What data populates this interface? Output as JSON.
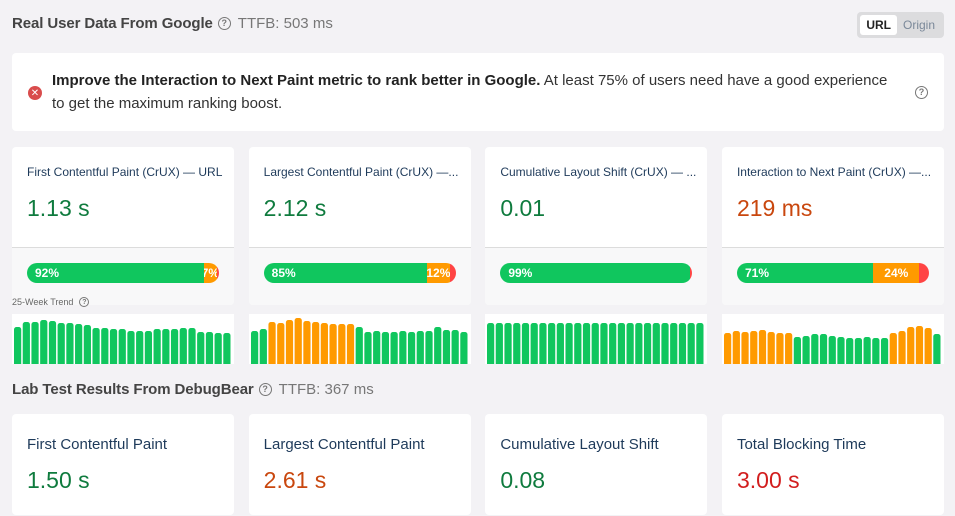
{
  "real_user": {
    "title": "Real User Data From Google",
    "ttfb": "TTFB: 503 ms",
    "help": "?",
    "toggle": {
      "options": [
        "URL",
        "Origin"
      ],
      "selected": "URL"
    }
  },
  "alert": {
    "icon": "error-icon",
    "bold_text": "Improve the Interaction to Next Paint metric to rank better in Google.",
    "text": " At least 75% of users need have a good experience to get the maximum ranking boost.",
    "help": "?"
  },
  "crux_cards": [
    {
      "title": "First Contentful Paint (CrUX) — URL",
      "value": "1.13 s",
      "rating": "good",
      "distribution": {
        "good": 92,
        "needs_improvement": 7,
        "poor": 1
      },
      "labels": {
        "good": "92%",
        "needs_improvement": "7%",
        "poor": ""
      }
    },
    {
      "title": "Largest Contentful Paint (CrUX) —...",
      "value": "2.12 s",
      "rating": "good",
      "distribution": {
        "good": 85,
        "needs_improvement": 12,
        "poor": 3
      },
      "labels": {
        "good": "85%",
        "needs_improvement": "12%",
        "poor": ""
      }
    },
    {
      "title": "Cumulative Layout Shift (CrUX) — ...",
      "value": "0.01",
      "rating": "good",
      "distribution": {
        "good": 99,
        "needs_improvement": 0,
        "poor": 1
      },
      "labels": {
        "good": "99%",
        "needs_improvement": "",
        "poor": ""
      }
    },
    {
      "title": "Interaction to Next Paint (CrUX) —...",
      "value": "219 ms",
      "rating": "ni",
      "distribution": {
        "good": 71,
        "needs_improvement": 24,
        "poor": 5
      },
      "labels": {
        "good": "71%",
        "needs_improvement": "24%",
        "poor": ""
      }
    }
  ],
  "trend": {
    "label": "25-Week Trend",
    "help": "?",
    "colors": {
      "good": "#10c65e",
      "ni": "#ff9a00"
    },
    "series": [
      {
        "metric": "fcp",
        "values": [
          0.74,
          0.84,
          0.84,
          0.88,
          0.86,
          0.82,
          0.82,
          0.8,
          0.78,
          0.72,
          0.72,
          0.7,
          0.7,
          0.66,
          0.66,
          0.66,
          0.7,
          0.7,
          0.7,
          0.72,
          0.72,
          0.64,
          0.64,
          0.62,
          0.62
        ],
        "ratings": [
          "good",
          "good",
          "good",
          "good",
          "good",
          "good",
          "good",
          "good",
          "good",
          "good",
          "good",
          "good",
          "good",
          "good",
          "good",
          "good",
          "good",
          "good",
          "good",
          "good",
          "good",
          "good",
          "good",
          "good",
          "good"
        ]
      },
      {
        "metric": "lcp",
        "values": [
          0.66,
          0.7,
          0.84,
          0.82,
          0.88,
          0.92,
          0.86,
          0.84,
          0.82,
          0.8,
          0.8,
          0.8,
          0.74,
          0.64,
          0.66,
          0.64,
          0.64,
          0.66,
          0.64,
          0.66,
          0.66,
          0.74,
          0.68,
          0.68,
          0.64
        ],
        "ratings": [
          "good",
          "good",
          "ni",
          "ni",
          "ni",
          "ni",
          "ni",
          "ni",
          "ni",
          "ni",
          "ni",
          "ni",
          "good",
          "good",
          "good",
          "good",
          "good",
          "good",
          "good",
          "good",
          "good",
          "good",
          "good",
          "good",
          "good"
        ]
      },
      {
        "metric": "cls",
        "values": [
          0.82,
          0.82,
          0.82,
          0.82,
          0.82,
          0.82,
          0.82,
          0.82,
          0.82,
          0.82,
          0.82,
          0.82,
          0.82,
          0.82,
          0.82,
          0.82,
          0.82,
          0.82,
          0.82,
          0.82,
          0.82,
          0.82,
          0.82,
          0.82,
          0.82
        ],
        "ratings": [
          "good",
          "good",
          "good",
          "good",
          "good",
          "good",
          "good",
          "good",
          "good",
          "good",
          "good",
          "good",
          "good",
          "good",
          "good",
          "good",
          "good",
          "good",
          "good",
          "good",
          "good",
          "good",
          "good",
          "good",
          "good"
        ]
      },
      {
        "metric": "inp",
        "values": [
          0.62,
          0.66,
          0.64,
          0.66,
          0.68,
          0.64,
          0.62,
          0.62,
          0.54,
          0.56,
          0.6,
          0.6,
          0.56,
          0.54,
          0.52,
          0.52,
          0.54,
          0.52,
          0.52,
          0.62,
          0.66,
          0.74,
          0.76,
          0.72,
          0.6
        ],
        "ratings": [
          "ni",
          "ni",
          "ni",
          "ni",
          "ni",
          "ni",
          "ni",
          "ni",
          "good",
          "good",
          "good",
          "good",
          "good",
          "good",
          "good",
          "good",
          "good",
          "good",
          "good",
          "ni",
          "ni",
          "ni",
          "ni",
          "ni",
          "good"
        ]
      }
    ]
  },
  "lab": {
    "title": "Lab Test Results From DebugBear",
    "ttfb": "TTFB: 367 ms",
    "help": "?",
    "cards": [
      {
        "title": "First Contentful Paint",
        "value": "1.50 s",
        "rating": "good"
      },
      {
        "title": "Largest Contentful Paint",
        "value": "2.61 s",
        "rating": "ni"
      },
      {
        "title": "Cumulative Layout Shift",
        "value": "0.08",
        "rating": "good"
      },
      {
        "title": "Total Blocking Time",
        "value": "3.00 s",
        "rating": "poor"
      }
    ]
  }
}
